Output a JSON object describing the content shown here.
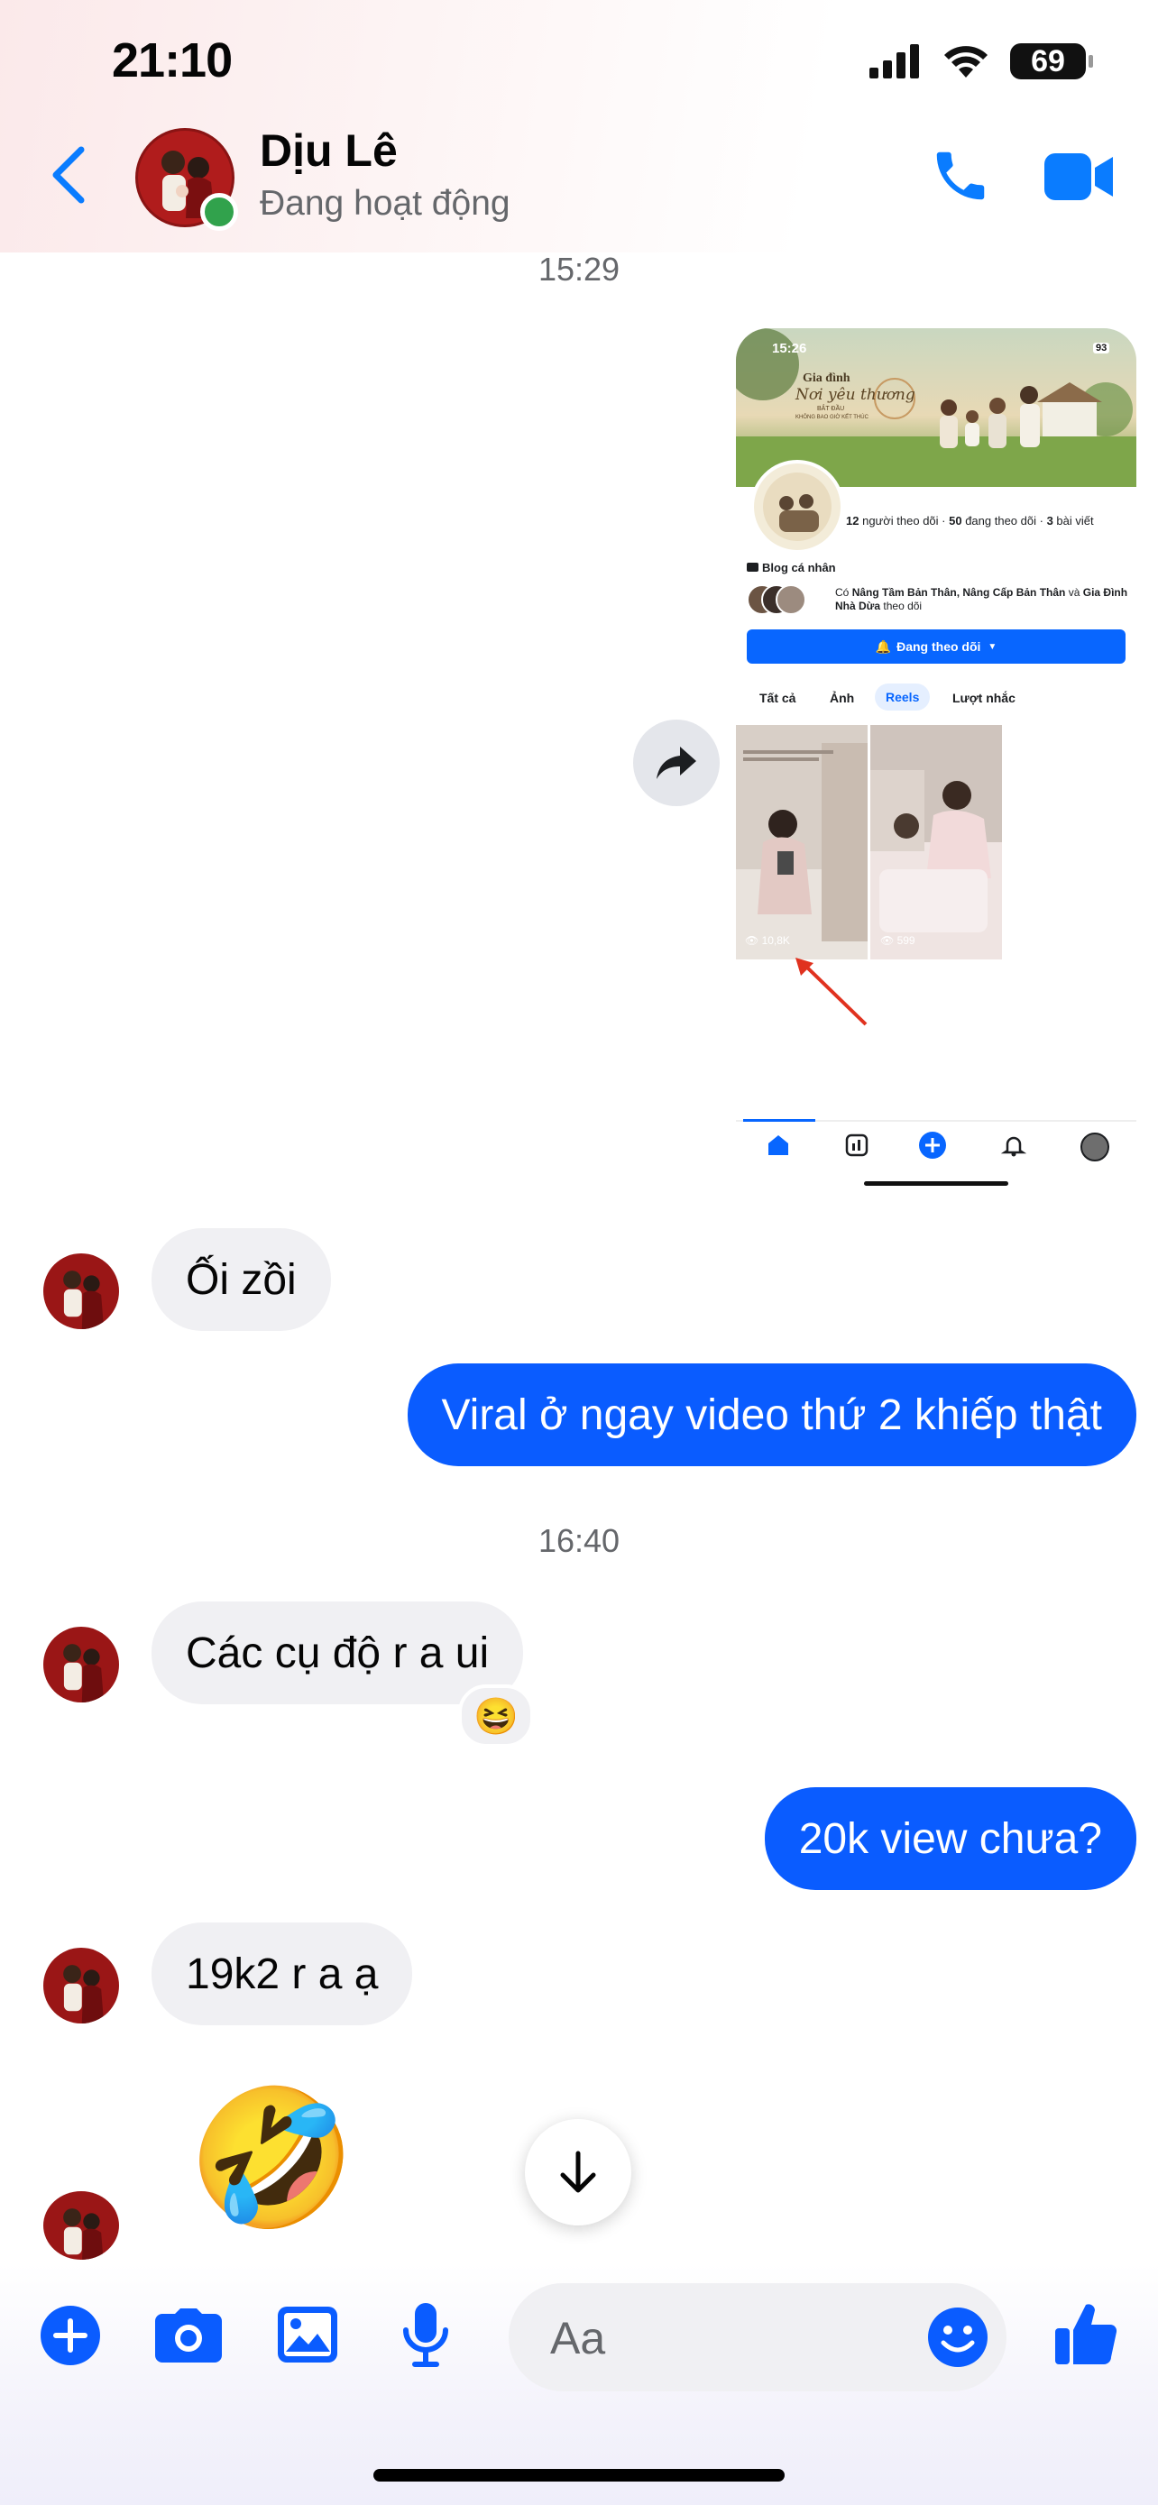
{
  "status_bar": {
    "time": "21:10",
    "battery": "69"
  },
  "header": {
    "name": "Dịu Lê",
    "status": "Đang hoạt động"
  },
  "messages": {
    "ts1": "15:29",
    "shot": {
      "time": "15:26",
      "battery": "93",
      "cover_line1": "Gia đình",
      "cover_line2": "Nơi yêu thương",
      "cover_line3": "BẮT ĐẦU",
      "cover_line4": "KHÔNG BAO GIỜ KẾT THÚC",
      "followers": "12",
      "followers_label": "người theo dõi",
      "following": "50",
      "following_label": "đang theo dõi",
      "posts": "3",
      "posts_label": "bài viết",
      "category": "Blog cá nhân",
      "mutual_prefix": "Có ",
      "mutual_names": "Nâng Tầm Bản Thân, Nâng Cấp Bản Thân",
      "mutual_and": " và",
      "mutual_name2": "Gia Đình Nhà Dừa",
      "mutual_suffix": " theo dõi",
      "follow_button": "Đang theo dõi",
      "tabs": [
        "Tất cả",
        "Ảnh",
        "Reels",
        "Lượt nhắc"
      ],
      "reel1_views": "10,8K",
      "reel2_views": "599"
    },
    "m1": "Ối zồi",
    "m2": "Viral ở ngay video thứ 2 khiếp thật",
    "ts2": "16:40",
    "m3": "Các cụ độ r a ui",
    "m3_reaction": "😆",
    "m4": "20k view chưa?",
    "m5": "19k2 r a ạ",
    "m6_emoji": "🤣"
  },
  "composer": {
    "placeholder": "Aa"
  },
  "colors": {
    "accent": "#0a5cff",
    "icon_blue": "#1877f2",
    "incoming_bubble": "#f0f0f3",
    "online": "#31a24c"
  }
}
